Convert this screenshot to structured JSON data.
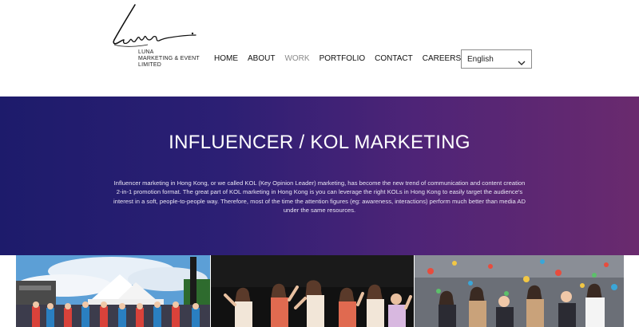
{
  "brand": {
    "logo_script": "Luna",
    "company_lines": [
      "LUNA",
      "MARKETING & EVENT",
      "LIMITED"
    ]
  },
  "nav": {
    "items": [
      {
        "label": "HOME"
      },
      {
        "label": "ABOUT"
      },
      {
        "label": "WORK"
      },
      {
        "label": "PORTFOLIO"
      },
      {
        "label": "CONTACT"
      },
      {
        "label": "CAREERS"
      }
    ],
    "active": "WORK"
  },
  "language": {
    "selected": "English"
  },
  "hero": {
    "title": "INFLUENCER / KOL MARKETING",
    "body": "Influencer marketing in Hong Kong, or we called KOL (Key Opinion Leader) marketing, has become the new trend of communication and content creation 2-in-1 promotion format. The great part of KOL marketing in Hong Kong is you can leverage the right KOLs in Hong Kong to easily target the audience's interest in a soft, people-to-people way. Therefore, most of the time the attention figures (eg: awareness, interactions) perform much better than media AD under the same resources."
  },
  "colors": {
    "hero_gradient_start": "#1d1b6b",
    "hero_gradient_end": "#6a2a6e",
    "nav_active": "#8a8a8a"
  },
  "photos": [
    {
      "subject": "outdoor-event-tent-crowd-photo"
    },
    {
      "subject": "dance-group-stage-photo"
    },
    {
      "subject": "climbing-wall-group-photo"
    }
  ]
}
